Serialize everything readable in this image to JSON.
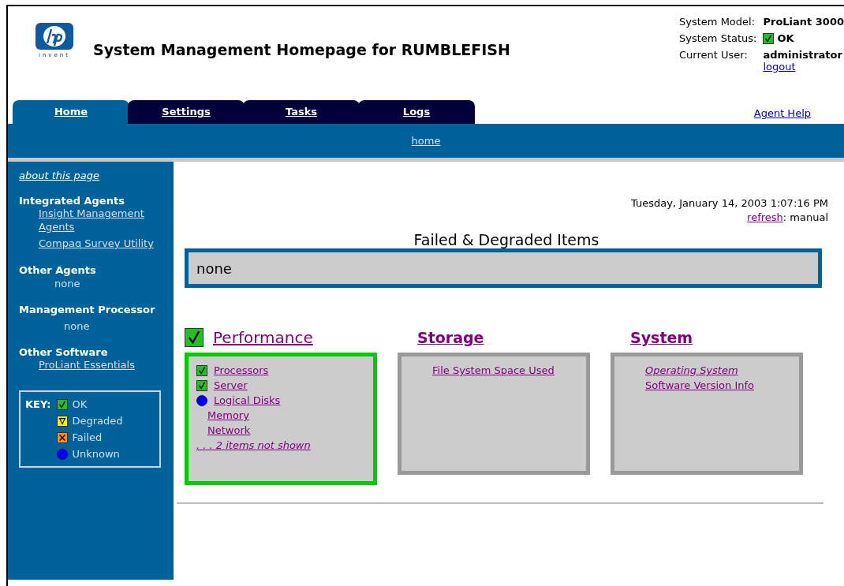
{
  "header": {
    "logo_text": "invent",
    "title": "System Management Homepage for RUMBLEFISH",
    "info": [
      {
        "label": "System Model:",
        "value": "ProLiant 3000"
      },
      {
        "label": "System Status:",
        "value": "OK",
        "kind": "ok"
      },
      {
        "label": "Current User:",
        "value": "administrator",
        "link": "logout"
      }
    ]
  },
  "tabs": [
    {
      "label": "Home",
      "selected": true
    },
    {
      "label": "Settings",
      "selected": false
    },
    {
      "label": "Tasks",
      "selected": false
    },
    {
      "label": "Logs",
      "selected": false
    }
  ],
  "agent_help": "Agent Help",
  "breadcrumb": "home",
  "sidebar": {
    "about": "about this page",
    "sections": [
      {
        "title": "Integrated Agents",
        "links": [
          "Insight Management Agents",
          "Compaq Survey Utility"
        ]
      },
      {
        "title": "Other Agents",
        "none": "none"
      },
      {
        "title": "Management Processor",
        "none": "none"
      },
      {
        "title": "Other Software",
        "links": [
          "ProLiant Essentials"
        ]
      }
    ],
    "key": {
      "title": "KEY:",
      "items": [
        {
          "kind": "ok",
          "label": "OK"
        },
        {
          "kind": "degraded",
          "label": "Degraded"
        },
        {
          "kind": "failed",
          "label": "Failed"
        },
        {
          "kind": "unknown",
          "label": "Unknown"
        }
      ]
    }
  },
  "main": {
    "timestamp": "Tuesday, January 14, 2003 1:07:16 PM",
    "refresh_link": "refresh",
    "refresh_value": ": manual",
    "failed_title": "Failed & Degraded Items",
    "failed_value": "none",
    "panels": [
      {
        "title": "Performance",
        "kind": "ok",
        "items": [
          {
            "label": "Processors",
            "kind": "ok",
            "italic": false
          },
          {
            "label": "Server",
            "kind": "ok",
            "italic": false
          },
          {
            "label": "Logical Disks",
            "kind": "unknown",
            "italic": false
          },
          {
            "label": "Memory",
            "kind": "plain",
            "italic": false
          },
          {
            "label": "Network",
            "kind": "plain",
            "italic": false
          },
          {
            "label": ". . . 2 items not shown",
            "kind": "more",
            "italic": true
          }
        ]
      },
      {
        "title": "Storage",
        "kind": "plain",
        "items": [
          {
            "label": "File System Space Used",
            "kind": "plain",
            "italic": false
          }
        ]
      },
      {
        "title": "System",
        "kind": "plain",
        "items": [
          {
            "label": "Operating System",
            "kind": "plain",
            "italic": true
          },
          {
            "label": "Software Version Info",
            "kind": "plain",
            "italic": false
          }
        ]
      }
    ]
  }
}
